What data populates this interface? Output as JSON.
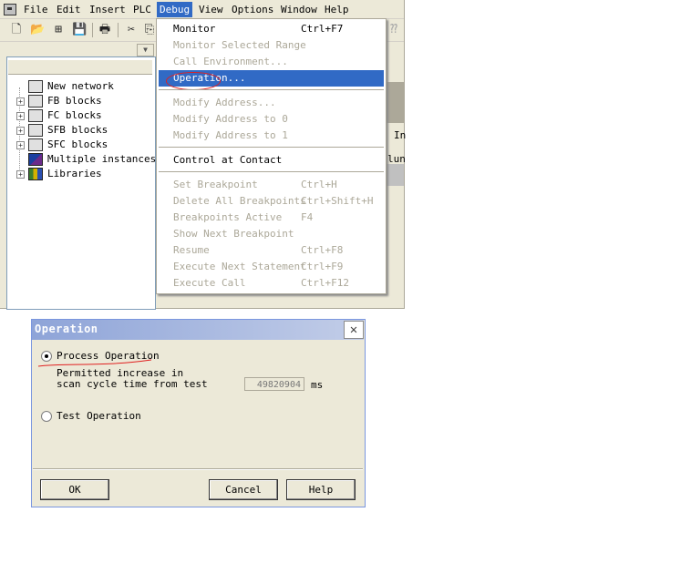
{
  "menubar": {
    "items": [
      "File",
      "Edit",
      "Insert",
      "PLC",
      "Debug",
      "View",
      "Options",
      "Window",
      "Help"
    ],
    "active": "Debug"
  },
  "tree": {
    "items": [
      {
        "label": "New network",
        "icon": "network-icon",
        "expandable": false
      },
      {
        "label": "FB blocks",
        "icon": "block-folder-icon",
        "expandable": true
      },
      {
        "label": "FC blocks",
        "icon": "block-folder-icon",
        "expandable": true
      },
      {
        "label": "SFB blocks",
        "icon": "block-folder-icon",
        "expandable": true
      },
      {
        "label": "SFC blocks",
        "icon": "block-folder-icon",
        "expandable": true
      },
      {
        "label": "Multiple instances",
        "icon": "multiple-instances-icon",
        "expandable": false
      },
      {
        "label": "Libraries",
        "icon": "libraries-icon",
        "expandable": true
      }
    ]
  },
  "background_fragments": [
    "In",
    "lun"
  ],
  "debug_menu": {
    "items": [
      {
        "label": "Monitor",
        "shortcut": "Ctrl+F7",
        "enabled": true
      },
      {
        "label": "Monitor Selected Range",
        "shortcut": "",
        "enabled": false
      },
      {
        "label": "Call Environment...",
        "shortcut": "",
        "enabled": false
      },
      {
        "label": "Operation...",
        "shortcut": "",
        "enabled": true,
        "highlighted": true
      },
      {
        "label": "Modify Address...",
        "shortcut": "",
        "enabled": false
      },
      {
        "label": "Modify Address to 0",
        "shortcut": "",
        "enabled": false
      },
      {
        "label": "Modify Address to 1",
        "shortcut": "",
        "enabled": false
      },
      {
        "label": "Control at Contact",
        "shortcut": "",
        "enabled": true
      },
      {
        "label": "Set Breakpoint",
        "shortcut": "Ctrl+H",
        "enabled": false
      },
      {
        "label": "Delete All Breakpoints",
        "shortcut": "Ctrl+Shift+H",
        "enabled": false
      },
      {
        "label": "Breakpoints Active",
        "shortcut": "F4",
        "enabled": false
      },
      {
        "label": "Show Next Breakpoint",
        "shortcut": "",
        "enabled": false
      },
      {
        "label": "Resume",
        "shortcut": "Ctrl+F8",
        "enabled": false
      },
      {
        "label": "Execute Next Statement",
        "shortcut": "Ctrl+F9",
        "enabled": false
      },
      {
        "label": "Execute Call",
        "shortcut": "Ctrl+F12",
        "enabled": false
      }
    ]
  },
  "dialog": {
    "title": "Operation",
    "process_label": "Process Operation",
    "process_selected": true,
    "desc_line1": "Permitted increase in",
    "desc_line2": "scan cycle time from test",
    "value": "49820904",
    "unit": "ms",
    "test_label": "Test Operation",
    "ok": "OK",
    "cancel": "Cancel",
    "help": "Help",
    "close_glyph": "✕"
  }
}
